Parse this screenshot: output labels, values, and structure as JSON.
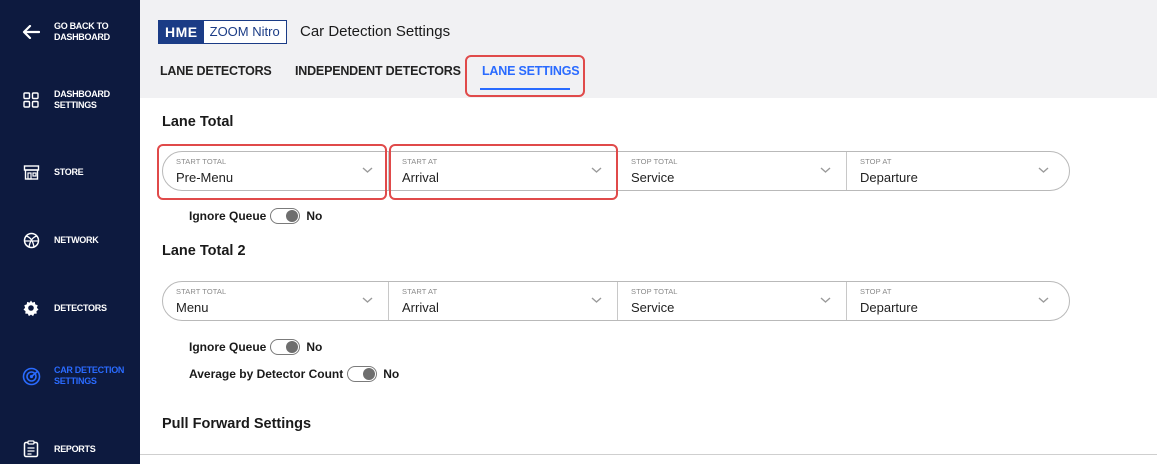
{
  "sidebar": {
    "items": [
      {
        "label": "GO BACK TO DASHBOARD",
        "icon": "arrow-left-icon"
      },
      {
        "label": "DASHBOARD SETTINGS",
        "icon": "grid-icon"
      },
      {
        "label": "STORE",
        "icon": "store-icon"
      },
      {
        "label": "NETWORK",
        "icon": "globe-icon"
      },
      {
        "label": "DETECTORS",
        "icon": "gear-icon"
      },
      {
        "label": "CAR DETECTION SETTINGS",
        "icon": "radar-icon",
        "active": true
      },
      {
        "label": "REPORTS",
        "icon": "clipboard-icon"
      }
    ],
    "active_color": "#2a6bff",
    "background": "#0d1a3f"
  },
  "header": {
    "logo_brand": "HME",
    "logo_product": "ZOOM Nitro",
    "page_title": "Car Detection Settings",
    "tabs": [
      {
        "label": "LANE DETECTORS"
      },
      {
        "label": "INDEPENDENT DETECTORS"
      },
      {
        "label": "LANE SETTINGS",
        "active": true
      }
    ]
  },
  "lane_total": {
    "title": "Lane Total",
    "selects": [
      {
        "label": "START TOTAL",
        "value": "Pre-Menu"
      },
      {
        "label": "START AT",
        "value": "Arrival"
      },
      {
        "label": "STOP TOTAL",
        "value": "Service"
      },
      {
        "label": "STOP AT",
        "value": "Departure"
      }
    ],
    "ignore_queue": {
      "label": "Ignore Queue",
      "value": "No"
    }
  },
  "lane_total_2": {
    "title": "Lane Total 2",
    "selects": [
      {
        "label": "START TOTAL",
        "value": "Menu"
      },
      {
        "label": "START AT",
        "value": "Arrival"
      },
      {
        "label": "STOP TOTAL",
        "value": "Service"
      },
      {
        "label": "STOP AT",
        "value": "Departure"
      }
    ],
    "ignore_queue": {
      "label": "Ignore Queue",
      "value": "No"
    },
    "average_by_detector": {
      "label": "Average by Detector Count",
      "value": "No"
    }
  },
  "pull_forward": {
    "title": "Pull Forward Settings"
  },
  "colors": {
    "accent": "#2a6bff",
    "highlight": "#e04a4a",
    "brand": "#1b3c86"
  }
}
